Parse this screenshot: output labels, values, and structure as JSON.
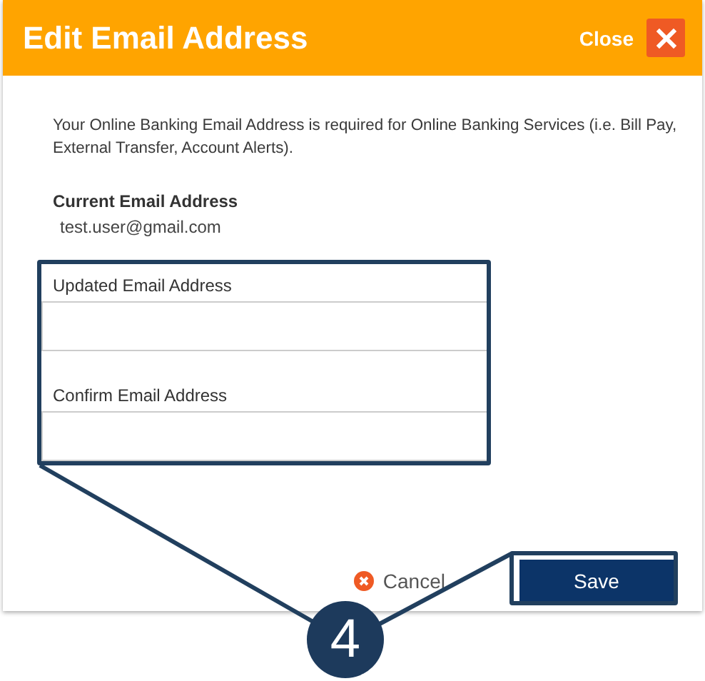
{
  "dialog": {
    "title": "Edit Email Address",
    "close_label": "Close"
  },
  "intro": "Your Online Banking Email Address is required for Online Banking Services (i.e. Bill Pay, External Transfer, Account Alerts).",
  "current": {
    "label": "Current Email Address",
    "value": "test.user@gmail.com"
  },
  "fields": [
    {
      "label": "Updated Email Address"
    },
    {
      "label": "Confirm Email Address"
    }
  ],
  "buttons": {
    "cancel": "Cancel",
    "save": "Save"
  },
  "annotation": {
    "step": "4"
  }
}
